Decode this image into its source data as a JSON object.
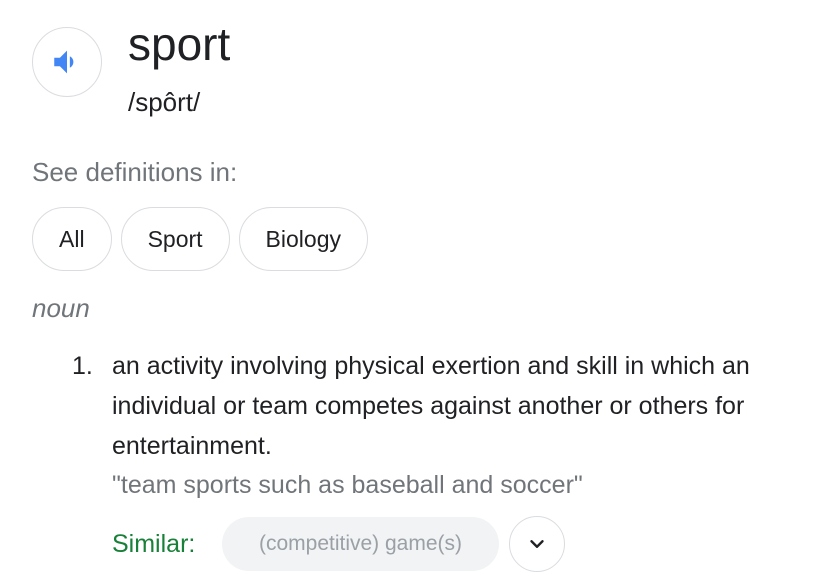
{
  "entry": {
    "word": "sport",
    "phonetic": "/spôrt/",
    "audio_icon": "speaker-icon",
    "accent_color": "#4285f4"
  },
  "see_definitions": {
    "label": "See definitions in:",
    "chips": [
      "All",
      "Sport",
      "Biology"
    ]
  },
  "definition": {
    "part_of_speech": "noun",
    "number": "1.",
    "text": "an activity involving physical exertion and skill in which an individual or team competes against another or others for entertainment.",
    "example": "\"team sports such as baseball and soccer\"",
    "similar_label": "Similar:",
    "similar_label_color": "#188038",
    "similar_items": [
      "(competitive) game(s)"
    ],
    "expand_icon": "chevron-down-icon"
  }
}
